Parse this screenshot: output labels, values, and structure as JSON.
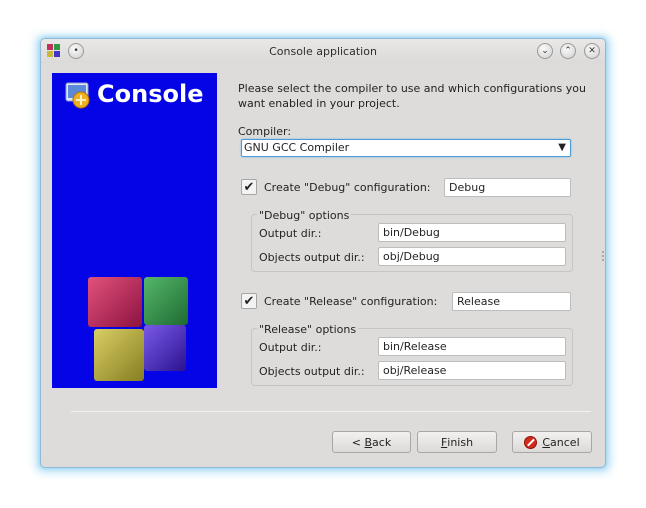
{
  "window": {
    "title": "Console application",
    "controls": [
      "circle-menu-icon",
      "minimize-chevron-icon",
      "maximize-chevron-icon",
      "close-x-icon"
    ]
  },
  "banner": {
    "title": "Console",
    "background": "#0404e6",
    "cube_colors": [
      "#b8215c",
      "#2f8f45",
      "#a8a037",
      "#4a2bbd"
    ]
  },
  "form": {
    "intro": "Please select the compiler to use and which configurations you want enabled in your project.",
    "compiler_label": "Compiler:",
    "compiler_value": "GNU GCC Compiler",
    "debug": {
      "checkbox_label": "Create \"Debug\" configuration:",
      "checked": true,
      "name_value": "Debug",
      "group_title": "\"Debug\" options",
      "output_label": "Output dir.:",
      "output_value": "bin/Debug",
      "objects_label": "Objects output dir.:",
      "objects_value": "obj/Debug"
    },
    "release": {
      "checkbox_label": "Create \"Release\" configuration:",
      "checked": true,
      "name_value": "Release",
      "group_title": "\"Release\" options",
      "output_label": "Output dir.:",
      "output_value": "bin/Release",
      "objects_label": "Objects output dir.:",
      "objects_value": "obj/Release"
    }
  },
  "buttons": {
    "back_prefix": "< ",
    "back_mnemonic": "B",
    "back_rest": "ack",
    "finish_mnemonic": "F",
    "finish_rest": "inish",
    "cancel_mnemonic": "C",
    "cancel_rest": "ancel"
  }
}
